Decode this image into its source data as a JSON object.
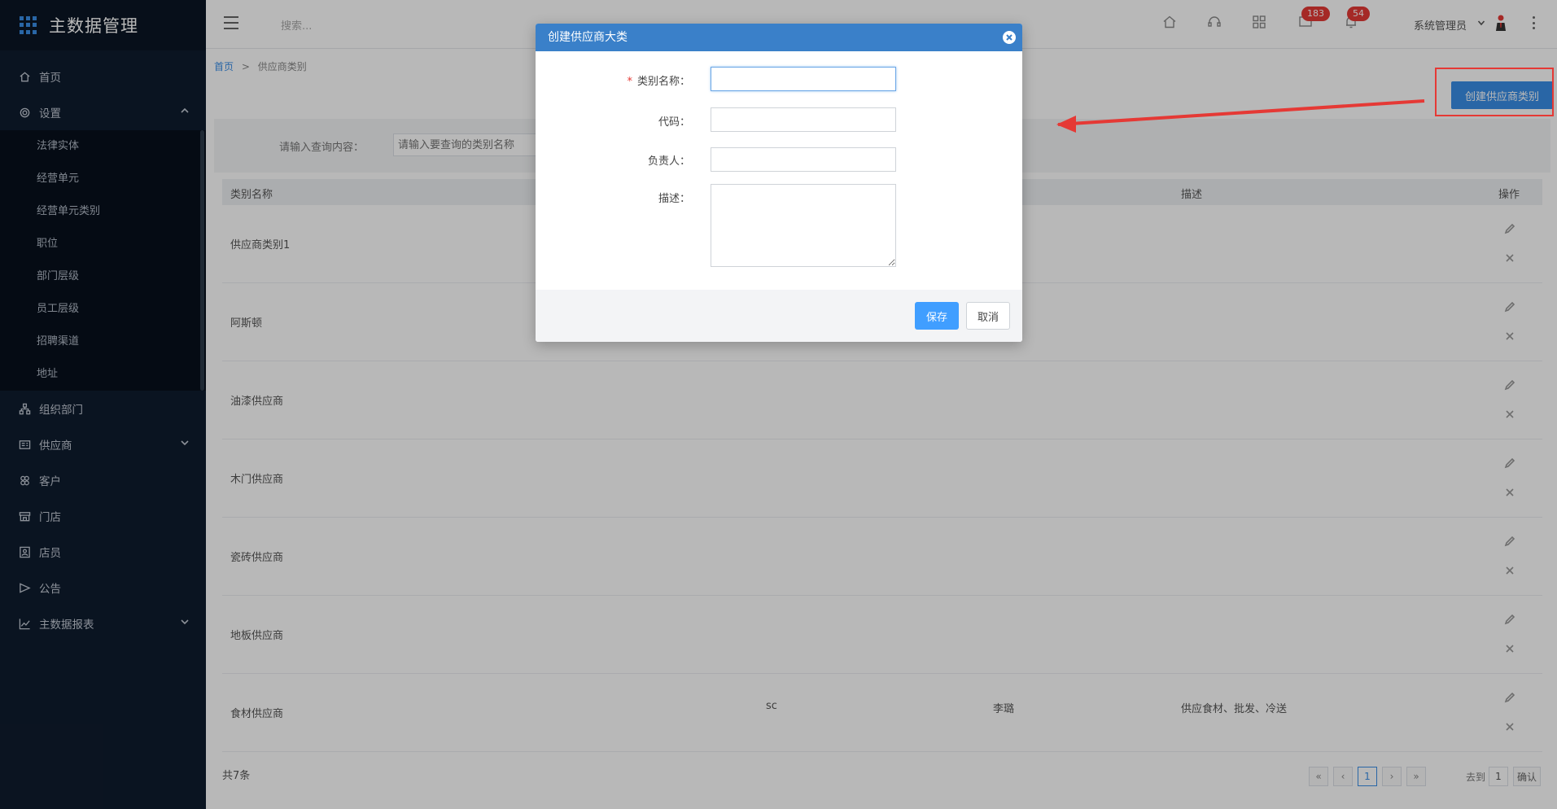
{
  "app": {
    "title": "主数据管理"
  },
  "sidebar": {
    "items": [
      {
        "label": "首页",
        "icon": "home-icon"
      },
      {
        "label": "设置",
        "icon": "gear-icon",
        "expanded": true,
        "children": [
          "法律实体",
          "经营单元",
          "经营单元类别",
          "职位",
          "部门层级",
          "员工层级",
          "招聘渠道",
          "地址"
        ]
      },
      {
        "label": "组织部门",
        "icon": "org-icon"
      },
      {
        "label": "供应商",
        "icon": "supplier-icon"
      },
      {
        "label": "客户",
        "icon": "customer-icon"
      },
      {
        "label": "门店",
        "icon": "store-icon"
      },
      {
        "label": "店员",
        "icon": "clerk-icon"
      },
      {
        "label": "公告",
        "icon": "notice-icon"
      },
      {
        "label": "主数据报表",
        "icon": "report-icon"
      }
    ]
  },
  "topbar": {
    "search_placeholder": "搜索...",
    "badge_messages": "183",
    "badge_notifications": "54",
    "user_name": "系统管理员"
  },
  "breadcrumb": {
    "home": "首页",
    "separator": ">",
    "current": "供应商类别"
  },
  "create_button_label": "创建供应商类别",
  "query": {
    "label": "请输入查询内容：",
    "placeholder": "请输入要查询的类别名称"
  },
  "table": {
    "columns": [
      "类别名称",
      "描述",
      "操作"
    ],
    "rows": [
      {
        "name": "供应商类别1",
        "code": "",
        "owner": "",
        "desc": ""
      },
      {
        "name": "阿斯顿",
        "code": "",
        "owner": "",
        "desc": ""
      },
      {
        "name": "油漆供应商",
        "code": "",
        "owner": "",
        "desc": ""
      },
      {
        "name": "木门供应商",
        "code": "",
        "owner": "",
        "desc": ""
      },
      {
        "name": "瓷砖供应商",
        "code": "",
        "owner": "",
        "desc": ""
      },
      {
        "name": "地板供应商",
        "code": "",
        "owner": "",
        "desc": ""
      },
      {
        "name": "食材供应商",
        "code": "sc",
        "owner": "李璐",
        "desc": "供应食材、批发、冷送"
      }
    ]
  },
  "footer": {
    "total": "共7条",
    "pager": {
      "first": "«",
      "prev": "‹",
      "current": "1",
      "next": "›",
      "last": "»"
    },
    "goto_label": "去到",
    "goto_value": "1",
    "goto_button": "确认"
  },
  "modal": {
    "title": "创建供应商大类",
    "required_mark": "*",
    "fields": {
      "name_label": "类别名称：",
      "code_label": "代码：",
      "owner_label": "负责人：",
      "desc_label": "描述："
    },
    "save_label": "保存",
    "cancel_label": "取消"
  },
  "colors": {
    "primary": "#3a8ee6",
    "sidebar_bg": "#0f1c2e",
    "modal_header": "#3a80c9",
    "badge": "#e53935",
    "annotation": "#e53935"
  }
}
